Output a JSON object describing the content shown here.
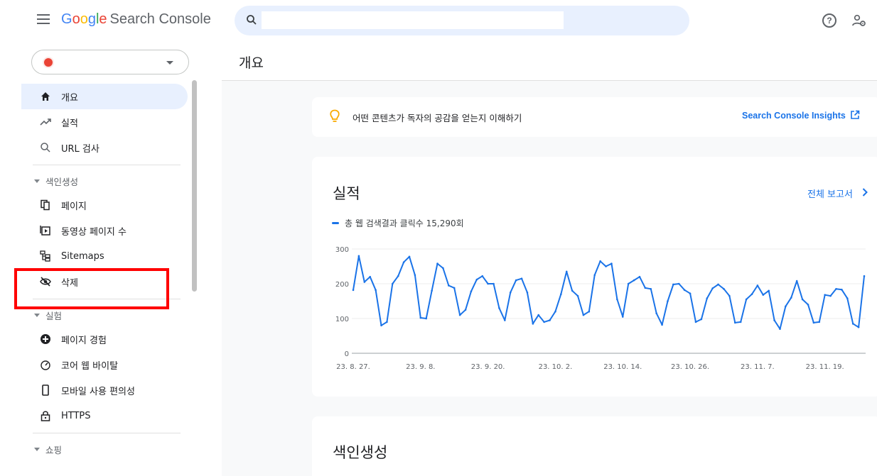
{
  "header": {
    "logo_google": [
      "G",
      "o",
      "o",
      "g",
      "l",
      "e"
    ],
    "app_name": "Search Console",
    "search_placeholder": ""
  },
  "property": {
    "name": ""
  },
  "sidebar": {
    "items_top": [
      {
        "label": "개요",
        "icon": "home-icon",
        "active": true
      },
      {
        "label": "실적",
        "icon": "trending-icon"
      },
      {
        "label": "URL 검사",
        "icon": "search-icon"
      }
    ],
    "sections": [
      {
        "title": "색인생성",
        "items": [
          {
            "label": "페이지",
            "icon": "pages-icon"
          },
          {
            "label": "동영상 페이지 수",
            "icon": "video-icon"
          },
          {
            "label": "Sitemaps",
            "icon": "sitemap-icon"
          },
          {
            "label": "삭제",
            "icon": "eye-off-icon"
          }
        ]
      },
      {
        "title": "실험",
        "items": [
          {
            "label": "페이지 경험",
            "icon": "plus-circle-icon"
          },
          {
            "label": "코어 웹 바이탈",
            "icon": "gauge-icon"
          },
          {
            "label": "모바일 사용 편의성",
            "icon": "phone-icon"
          },
          {
            "label": "HTTPS",
            "icon": "lock-icon"
          }
        ]
      },
      {
        "title": "쇼핑",
        "items": []
      }
    ]
  },
  "main": {
    "page_title": "개요",
    "insights": {
      "text": "어떤 콘텐츠가 독자의 공감을 얻는지 이해하기",
      "link": "Search Console Insights"
    },
    "performance": {
      "title": "실적",
      "full_report": "전체 보고서",
      "legend": "총 웹 검색결과 클릭수 15,290회"
    },
    "indexing": {
      "title": "색인생성"
    }
  },
  "colors": {
    "accent": "#1a73e8",
    "highlight_box": "#ff0000",
    "active_bg": "#e8f0fe"
  },
  "chart_data": {
    "type": "line",
    "ylim": [
      0,
      300
    ],
    "yticks": [
      0,
      100,
      200,
      300
    ],
    "xtick_labels": [
      "23. 8. 27.",
      "23. 9. 8.",
      "23. 9. 20.",
      "23. 10. 2.",
      "23. 10. 14.",
      "23. 10. 26.",
      "23. 11. 7.",
      "23. 11. 19."
    ],
    "xtick_index": [
      0,
      12,
      24,
      36,
      48,
      60,
      72,
      84
    ],
    "series": [
      {
        "name": "총 웹 검색결과 클릭수",
        "values": [
          182,
          280,
          205,
          220,
          182,
          80,
          90,
          200,
          222,
          262,
          278,
          225,
          102,
          100,
          180,
          258,
          245,
          195,
          188,
          110,
          125,
          178,
          212,
          222,
          200,
          200,
          130,
          95,
          175,
          210,
          215,
          175,
          85,
          110,
          90,
          95,
          120,
          170,
          235,
          180,
          165,
          110,
          120,
          225,
          265,
          250,
          258,
          155,
          105,
          200,
          210,
          220,
          188,
          185,
          115,
          82,
          150,
          198,
          200,
          182,
          172,
          90,
          98,
          158,
          187,
          198,
          185,
          165,
          88,
          90,
          155,
          170,
          195,
          168,
          180,
          95,
          70,
          135,
          160,
          208,
          155,
          140,
          88,
          90,
          168,
          165,
          185,
          183,
          158,
          85,
          75,
          222
        ]
      }
    ]
  }
}
